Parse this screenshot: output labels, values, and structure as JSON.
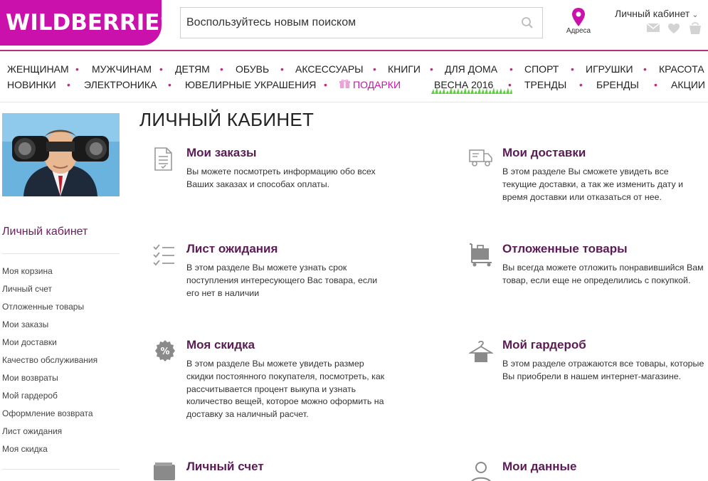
{
  "header": {
    "logo": "WILDBERRIES",
    "search_placeholder": "Воспользуйтесь новым поиском",
    "address_label": "Адреса",
    "cabinet_label": "Личный кабинет"
  },
  "nav": {
    "row1": [
      "ЖЕНЩИНАМ",
      "МУЖЧИНАМ",
      "ДЕТЯМ",
      "ОБУВЬ",
      "АКСЕССУАРЫ",
      "КНИГИ",
      "ДЛЯ ДОМА",
      "СПОРТ",
      "ИГРУШКИ",
      "КРАСОТА"
    ],
    "row2": [
      "НОВИНКИ",
      "ЭЛЕКТРОНИКА",
      "ЮВЕЛИРНЫЕ УКРАШЕНИЯ",
      "ПОДАРКИ",
      "ВЕСНА 2016",
      "ТРЕНДЫ",
      "БРЕНДЫ",
      "АКЦИИ"
    ]
  },
  "sidebar": {
    "title": "Личный кабинет",
    "items": [
      "Моя корзина",
      "Личный счет",
      "Отложенные товары",
      "Мои заказы",
      "Мои доставки",
      "Качество обслуживания",
      "Мои возвраты",
      "Мой гардероб",
      "Оформление возврата",
      "Лист ожидания",
      "Моя скидка"
    ]
  },
  "main": {
    "title": "ЛИЧНЫЙ КАБИНЕТ",
    "cards": [
      {
        "icon": "document-icon",
        "title": "Мои заказы",
        "text": "Вы можете посмотреть информацию обо всех Ваших заказах и способах оплаты."
      },
      {
        "icon": "truck-icon",
        "title": "Мои доставки",
        "text": "В этом разделе Вы сможете увидеть все текущие доставки, а так же изменить дату и время доставки или отказаться от нее."
      },
      {
        "icon": "checklist-icon",
        "title": "Лист ожидания",
        "text": "В этом разделе Вы можете узнать срок поступления интересующего Вас товара, если его нет в наличии"
      },
      {
        "icon": "cart-icon",
        "title": "Отложенные товары",
        "text": "Вы всегда можете отложить понравившийся Вам товар, если еще не определились с покупкой."
      },
      {
        "icon": "percent-icon",
        "title": "Моя скидка",
        "text": "В этом разделе Вы можете увидеть размер скидки постоянного покупателя, посмотреть, как рассчитывается процент выкупа и узнать количество вещей, которое можно оформить на доставку за наличный расчет."
      },
      {
        "icon": "hanger-icon",
        "title": "Мой гардероб",
        "text": "В этом разделе отражаются все товары, которые Вы приобрели в нашем интернет-магазине."
      },
      {
        "icon": "wallet-icon",
        "title": "Личный счет",
        "text": ""
      },
      {
        "icon": "user-icon",
        "title": "Мои данные",
        "text": ""
      }
    ]
  },
  "colors": {
    "brand": "#cb11ab",
    "accent": "#5b1c56",
    "nav_dot": "#b4337e"
  }
}
